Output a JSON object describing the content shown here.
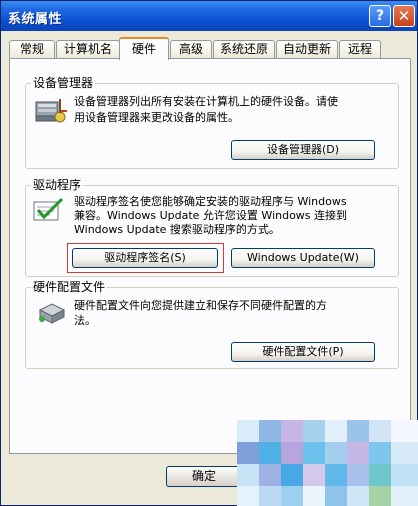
{
  "window": {
    "title": "系统属性",
    "help_glyph": "?",
    "close_glyph": "✕"
  },
  "tabs": [
    {
      "label": "常规"
    },
    {
      "label": "计算机名"
    },
    {
      "label": "硬件"
    },
    {
      "label": "高级"
    },
    {
      "label": "系统还原"
    },
    {
      "label": "自动更新"
    },
    {
      "label": "远程"
    }
  ],
  "active_tab": "硬件",
  "device_manager": {
    "title": "设备管理器",
    "description_line1": "设备管理器列出所有安装在计算机上的硬件设备。请使",
    "description_line2": "用设备管理器来更改设备的属性。",
    "button": "设备管理器(D)",
    "icon": "device-manager-icon"
  },
  "driver": {
    "title": "驱动程序",
    "description_line1": "驱动程序签名使您能够确定安装的驱动程序与 Windows",
    "description_line2": "兼容。Windows Update 允许您设置 Windows 连接到",
    "description_line3": "Windows Update 搜索驱动程序的方式。",
    "sign_button": "驱动程序签名(S)",
    "update_button": "Windows Update(W)",
    "icon": "driver-signing-icon"
  },
  "hw_profile": {
    "title": "硬件配置文件",
    "description_line1": "硬件配置文件向您提供建立和保存不同硬件配置的方",
    "description_line2": "法。",
    "button": "硬件配置文件(P)",
    "icon": "hardware-profile-icon"
  },
  "footer": {
    "ok": "确定"
  },
  "colors": {
    "title_bar": "#0b4fd1",
    "tab_accent": "#e68b2c",
    "highlight": "#d23a3a"
  }
}
